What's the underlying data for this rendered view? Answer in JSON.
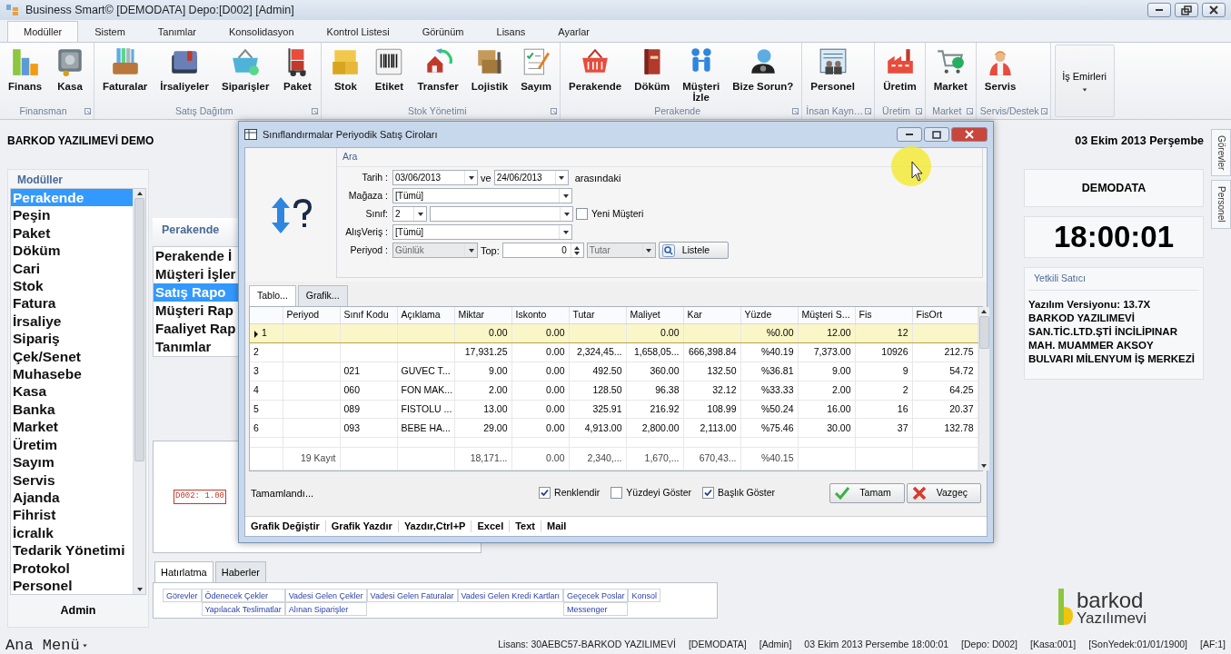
{
  "window": {
    "title": "Business Smart© [DEMODATA] Depo:[D002] [Admin]"
  },
  "ribbon_tabs": [
    {
      "label": "Modüller",
      "selected": true
    },
    {
      "label": "Sistem",
      "selected": false
    },
    {
      "label": "Tanımlar",
      "selected": false
    },
    {
      "label": "Konsolidasyon",
      "selected": false
    },
    {
      "label": "Kontrol Listesi",
      "selected": false
    },
    {
      "label": "Görünüm",
      "selected": false
    },
    {
      "label": "Lisans",
      "selected": false
    },
    {
      "label": "Ayarlar",
      "selected": false
    }
  ],
  "ribbon_groups": [
    {
      "label": "Finansman",
      "buttons": [
        "Finans",
        "Kasa"
      ]
    },
    {
      "label": "Satış Dağıtım",
      "buttons": [
        "Faturalar",
        "İrsaliyeler",
        "Siparişler",
        "Paket"
      ]
    },
    {
      "label": "Stok Yönetimi",
      "buttons": [
        "Stok",
        "Etiket",
        "Transfer",
        "Lojistik",
        "Sayım"
      ]
    },
    {
      "label": "Perakende",
      "buttons": [
        "Perakende",
        "Döküm",
        "Müşteri\nİzle",
        "Bize Sorun?"
      ]
    },
    {
      "label": "İnsan Kayn…",
      "buttons": [
        "Personel"
      ]
    },
    {
      "label": "Üretim",
      "buttons": [
        "Üretim"
      ]
    },
    {
      "label": "Market",
      "buttons": [
        "Market"
      ]
    },
    {
      "label": "Servis/Destek",
      "buttons": [
        "Servis"
      ]
    }
  ],
  "work_orders_button": "İş Emirleri",
  "company": "BARKOD YAZILIMEVİ DEMO",
  "date": "03 Ekim 2013 Perşembe",
  "modules": {
    "title": "Modüller",
    "user": "Admin",
    "items": [
      {
        "label": "Perakende",
        "selected": true
      },
      {
        "label": "Peşin",
        "selected": false
      },
      {
        "label": "Paket",
        "selected": false
      },
      {
        "label": "Döküm",
        "selected": false
      },
      {
        "label": "Cari",
        "selected": false
      },
      {
        "label": "Stok",
        "selected": false
      },
      {
        "label": "Fatura",
        "selected": false
      },
      {
        "label": "İrsaliye",
        "selected": false
      },
      {
        "label": "Sipariş",
        "selected": false
      },
      {
        "label": "Çek/Senet",
        "selected": false
      },
      {
        "label": "Muhasebe",
        "selected": false
      },
      {
        "label": "Kasa",
        "selected": false
      },
      {
        "label": "Banka",
        "selected": false
      },
      {
        "label": "Market",
        "selected": false
      },
      {
        "label": "Üretim",
        "selected": false
      },
      {
        "label": "Sayım",
        "selected": false
      },
      {
        "label": "Servis",
        "selected": false
      },
      {
        "label": "Ajanda",
        "selected": false
      },
      {
        "label": "Fihrist",
        "selected": false
      },
      {
        "label": "İcralık",
        "selected": false
      },
      {
        "label": "Tedarik Yönetimi",
        "selected": false
      },
      {
        "label": "Protokol",
        "selected": false
      },
      {
        "label": "Personel",
        "selected": false
      }
    ]
  },
  "report_panel": {
    "title": "Perakende",
    "items": [
      {
        "label": "Perakende İ",
        "selected": false
      },
      {
        "label": "Müşteri İşler",
        "selected": false
      },
      {
        "label": "Satış Rapo",
        "selected": true
      },
      {
        "label": "Müşteri Rap",
        "selected": false
      },
      {
        "label": "Faaliyet Rap",
        "selected": false
      },
      {
        "label": "Tanımlar",
        "selected": false
      }
    ],
    "chart_label": "D002: 1.00"
  },
  "reminders": {
    "tabs": [
      {
        "label": "Hatırlatma",
        "selected": true
      },
      {
        "label": "Haberler",
        "selected": false
      }
    ],
    "columns": [
      {
        "top": "Görevler"
      },
      {
        "top": "Ödenecek Çekler",
        "bottom": "Yapılacak Teslimatlar"
      },
      {
        "top": "Vadesi Gelen Çekler",
        "bottom": "Alınan Siparişler"
      },
      {
        "top": "Vadesi Gelen Faturalar"
      },
      {
        "top": "Vadesi Gelen Kredi Kartları"
      },
      {
        "top": "Geçecek Poslar",
        "bottom": "Messenger"
      },
      {
        "top": "Konsol"
      }
    ]
  },
  "info": {
    "database": "DEMODATA",
    "clock": "18:00:01",
    "dealer_title": "Yetkili Satıcı",
    "version": "Yazılım Versiyonu: 13.7X",
    "address": "BARKOD YAZILIMEVİ SAN.TİC.LTD.ŞTİ İNCİLİPINAR MAH. MUAMMER AKSOY BULVARI MİLENYUM İŞ MERKEZİ"
  },
  "side_tabs": [
    "Görevler",
    "Personel"
  ],
  "logo": {
    "brand": "barkod",
    "sub": "Yazılımevi"
  },
  "main_menu": "Ana Menü",
  "status_bar": [
    "Lisans: 30AEBC57-BARKOD YAZILIMEVİ",
    "[DEMODATA]",
    "[Admin]",
    "03 Ekim 2013 Persembe 18:00:01",
    "[Depo: D002]",
    "[Kasa:001]",
    "[SonYedek:01/01/1900]",
    "[AF:1]"
  ],
  "dialog": {
    "title": "Sınıflandırmalar Periyodik Satış Ciroları",
    "group": "Ara",
    "date": {
      "label": "Tarih :",
      "from": "03/06/2013",
      "joiner": "ve",
      "to": "24/06/2013",
      "suffix": "arasındaki"
    },
    "store": {
      "label": "Mağaza :",
      "value": "[Tümü]"
    },
    "class": {
      "label": "Sınıf:",
      "value": "2"
    },
    "new_customer": {
      "label": "Yeni Müşteri",
      "checked": false
    },
    "shopping": {
      "label": "AlışVeriş :",
      "value": "[Tümü]"
    },
    "period": {
      "label": "Periyod :",
      "value": "Günlük",
      "disabled": true
    },
    "top": {
      "label": "Top:",
      "value": "0"
    },
    "measure": {
      "value": "Tutar",
      "disabled": true
    },
    "list_button": "Listele",
    "tabs": [
      {
        "label": "Tablo...",
        "selected": true
      },
      {
        "label": "Grafik...",
        "selected": false
      }
    ],
    "table": {
      "columns": [
        "Periyod",
        "Sınıf Kodu",
        "Açıklama",
        "Miktar",
        "Iskonto",
        "Tutar",
        "Maliyet",
        "Kar",
        "Yüzde",
        "Müşteri S...",
        "Fis",
        "FisOrt"
      ],
      "rows": [
        {
          "number": "1",
          "selected": true,
          "cells": [
            null,
            null,
            null,
            "0.00",
            "0.00",
            null,
            "0.00",
            null,
            "%0.00",
            "12.00",
            "12",
            null
          ]
        },
        {
          "number": "2",
          "selected": false,
          "cells": [
            null,
            null,
            null,
            "17,931.25",
            "0.00",
            "2,324,45...",
            "1,658,05...",
            "666,398.84",
            "%40.19",
            "7,373.00",
            "10926",
            "212.75"
          ]
        },
        {
          "number": "3",
          "selected": false,
          "cells": [
            null,
            "021",
            "GUVEC T...",
            "9.00",
            "0.00",
            "492.50",
            "360.00",
            "132.50",
            "%36.81",
            "9.00",
            "9",
            "54.72"
          ]
        },
        {
          "number": "4",
          "selected": false,
          "cells": [
            null,
            "060",
            "FON MAK...",
            "2.00",
            "0.00",
            "128.50",
            "96.38",
            "32.12",
            "%33.33",
            "2.00",
            "2",
            "64.25"
          ]
        },
        {
          "number": "5",
          "selected": false,
          "cells": [
            null,
            "089",
            "FISTOLU ...",
            "13.00",
            "0.00",
            "325.91",
            "216.92",
            "108.99",
            "%50.24",
            "16.00",
            "16",
            "20.37"
          ]
        },
        {
          "number": "6",
          "selected": false,
          "cells": [
            null,
            "093",
            "BEBE HA...",
            "29.00",
            "0.00",
            "4,913.00",
            "2,800.00",
            "2,113.00",
            "%75.46",
            "30.00",
            "37",
            "132.78"
          ]
        }
      ],
      "totals": {
        "label": "19 Kayıt",
        "values": [
          "18,171...",
          "0.00",
          "2,340,...",
          "1,670,...",
          "670,43...",
          "%40.15"
        ]
      }
    },
    "status": "Tamamlandı...",
    "options": [
      {
        "label": "Renklendir",
        "checked": true
      },
      {
        "label": "Yüzdeyi Göster",
        "checked": false
      },
      {
        "label": "Başlık Göster",
        "checked": true
      }
    ],
    "buttons": [
      {
        "label": "Tamam",
        "kind": "ok"
      },
      {
        "label": "Vazgeç",
        "kind": "cancel"
      }
    ],
    "menu": [
      "Grafik Değiştir",
      "Grafik Yazdır",
      "Yazdır,Ctrl+P",
      "Excel",
      "Text",
      "Mail"
    ]
  }
}
